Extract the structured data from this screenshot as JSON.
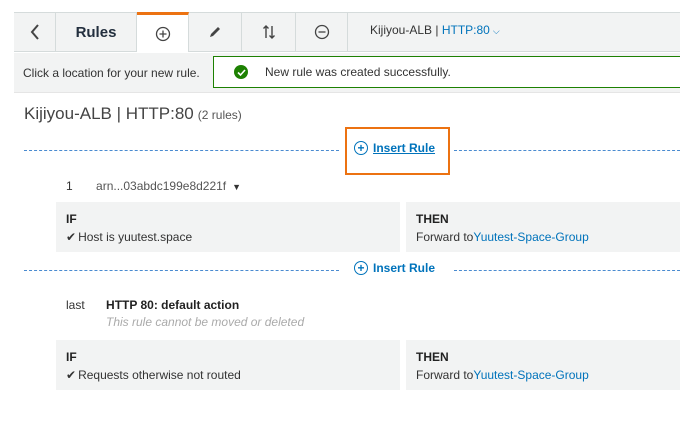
{
  "toolbar": {
    "title": "Rules",
    "lb_name": "Kijiyou-ALB",
    "lb_separator": " | ",
    "listener": "HTTP:80"
  },
  "status": {
    "hint": "Click a location for your new rule.",
    "flash": "New rule was created successfully."
  },
  "heading": {
    "title": "Kijiyou-ALB | HTTP:80",
    "count": "(2 rules)"
  },
  "insert_label": "Insert Rule",
  "rules": [
    {
      "priority": "1",
      "arn": "arn...03abdc199e8d221f",
      "if_label": "IF",
      "condition": "Host is yuutest.space",
      "then_label": "THEN",
      "action": "Forward to",
      "target": "Yuutest-Space-Group"
    },
    {
      "priority": "last",
      "title": "HTTP 80: default action",
      "note": "This rule cannot be moved or deleted",
      "if_label": "IF",
      "condition": "Requests otherwise not routed",
      "then_label": "THEN",
      "action": "Forward to",
      "target": "Yuutest-Space-Group"
    }
  ],
  "colors": {
    "accent": "#ec7211",
    "link": "#0073bb",
    "success": "#1d8102",
    "panel": "#f2f3f3"
  }
}
